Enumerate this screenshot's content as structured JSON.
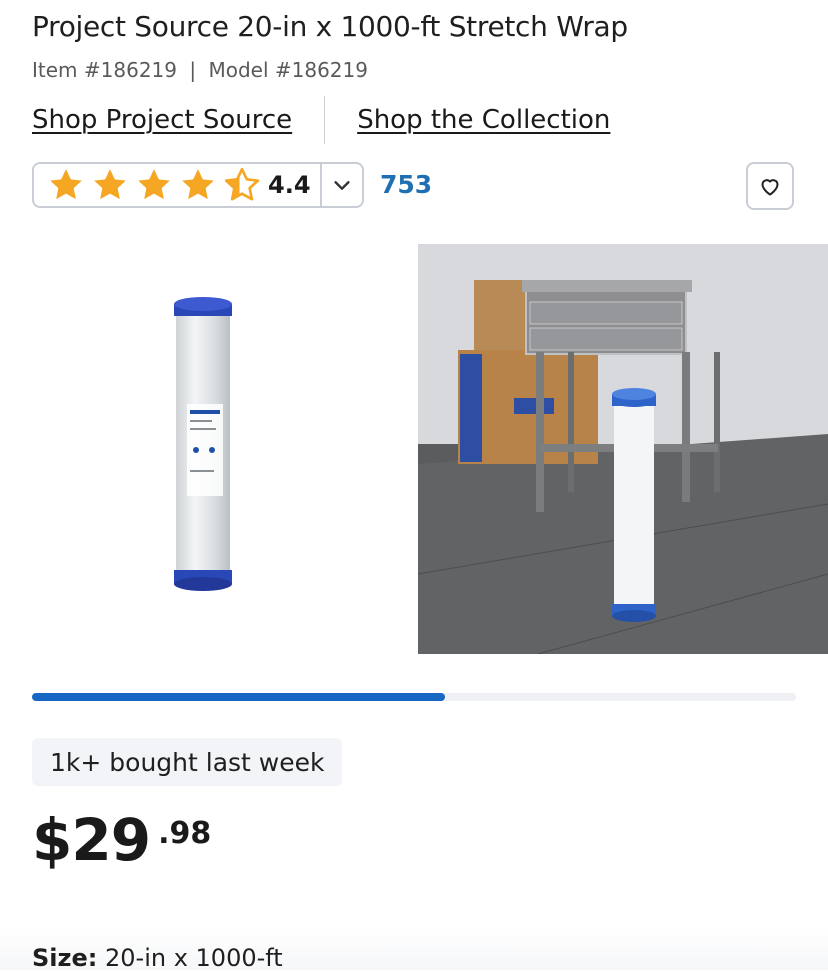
{
  "product": {
    "title": "Project Source 20-in x 1000-ft Stretch Wrap",
    "item_number": "Item #186219",
    "separator": "|",
    "model_number": "Model #186219"
  },
  "links": {
    "brand": "Shop Project Source",
    "collection": "Shop the Collection"
  },
  "rating": {
    "value": "4.4",
    "stars": 4.4,
    "review_count": "753",
    "star_color": "#f5a623"
  },
  "gallery": {
    "images": [
      "stretch-wrap-roll",
      "wrapped-table-scene"
    ],
    "progress_fraction": 0.54
  },
  "social_proof": "1k+ bought last week",
  "price": {
    "dollars": "$29",
    "cents": ".98"
  },
  "size": {
    "label": "Size:",
    "value": "20-in x 1000-ft"
  },
  "colors": {
    "link_blue": "#1f6fb2",
    "progress_blue": "#1768c4"
  }
}
